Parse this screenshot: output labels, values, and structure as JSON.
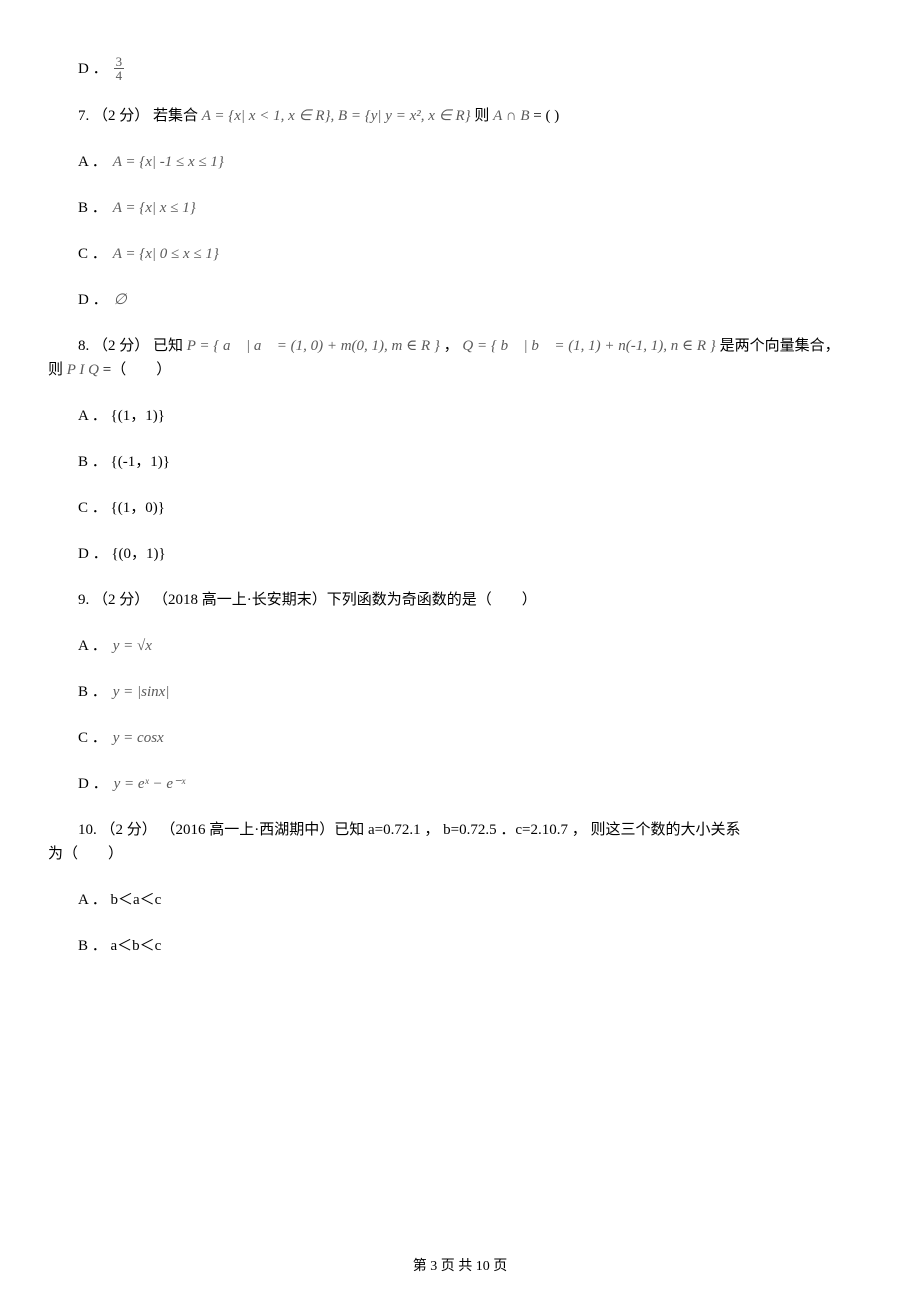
{
  "q6": {
    "optD_prefix": "D ．",
    "optD_frac_num": "3",
    "optD_frac_den": "4"
  },
  "q7": {
    "stem_prefix": "7. （2 分） 若集合",
    "set_A": "A = {x| x < 1, x ∈ R}, B = {y| y = x², x ∈ R}",
    "stem_mid": "则",
    "set_expr": "A ∩ B",
    "stem_suffix": " = (  )",
    "optA_prefix": "A ．",
    "optA_math": "A = {x| -1 ≤ x ≤ 1}",
    "optB_prefix": "B ．",
    "optB_math": "A = {x| x ≤ 1}",
    "optC_prefix": "C ．",
    "optC_math": "A = {x| 0 ≤ x ≤ 1}",
    "optD_prefix": "D ．",
    "optD_math": "∅"
  },
  "q8": {
    "stem_prefix": "8. （2 分） 已知",
    "setP": "P = { a⃗ | a⃗ = (1, 0) + m(0, 1), m ∈ R }",
    "comma": " ，",
    "setQ": "Q = { b⃗ | b⃗ = (1, 1) + n(-1, 1), n ∈ R }",
    "stem_suffix1": " 是两个向量集合，",
    "line2_prefix": "则",
    "PIQ": "P I Q",
    "line2_suffix": " =（　　）",
    "optA": "A ． {(1，1)}",
    "optB": "B ． {(-1，1)}",
    "optC": "C ． {(1，0)}",
    "optD": "D ． {(0，1)}"
  },
  "q9": {
    "stem": "9. （2 分） （2018 高一上·长安期末）下列函数为奇函数的是（　　）",
    "optA_prefix": "A ．",
    "optA_math": "y = √x",
    "optB_prefix": "B ．",
    "optB_math": "y = |sinx|",
    "optC_prefix": "C ．",
    "optC_math": "y = cosx",
    "optD_prefix": "D ．",
    "optD_math": "y = eˣ − e⁻ˣ"
  },
  "q10": {
    "stem_line1": "10. （2 分） （2016 高一上·西湖期中）已知 a=0.72.1 ， b=0.72.5 ．c=2.10.7 ， 则这三个数的大小关系",
    "stem_line2": "为（　　）",
    "optA": "A ． b＜a＜c",
    "optB": "B ． a＜b＜c"
  },
  "footer": "第 3 页 共 10 页"
}
